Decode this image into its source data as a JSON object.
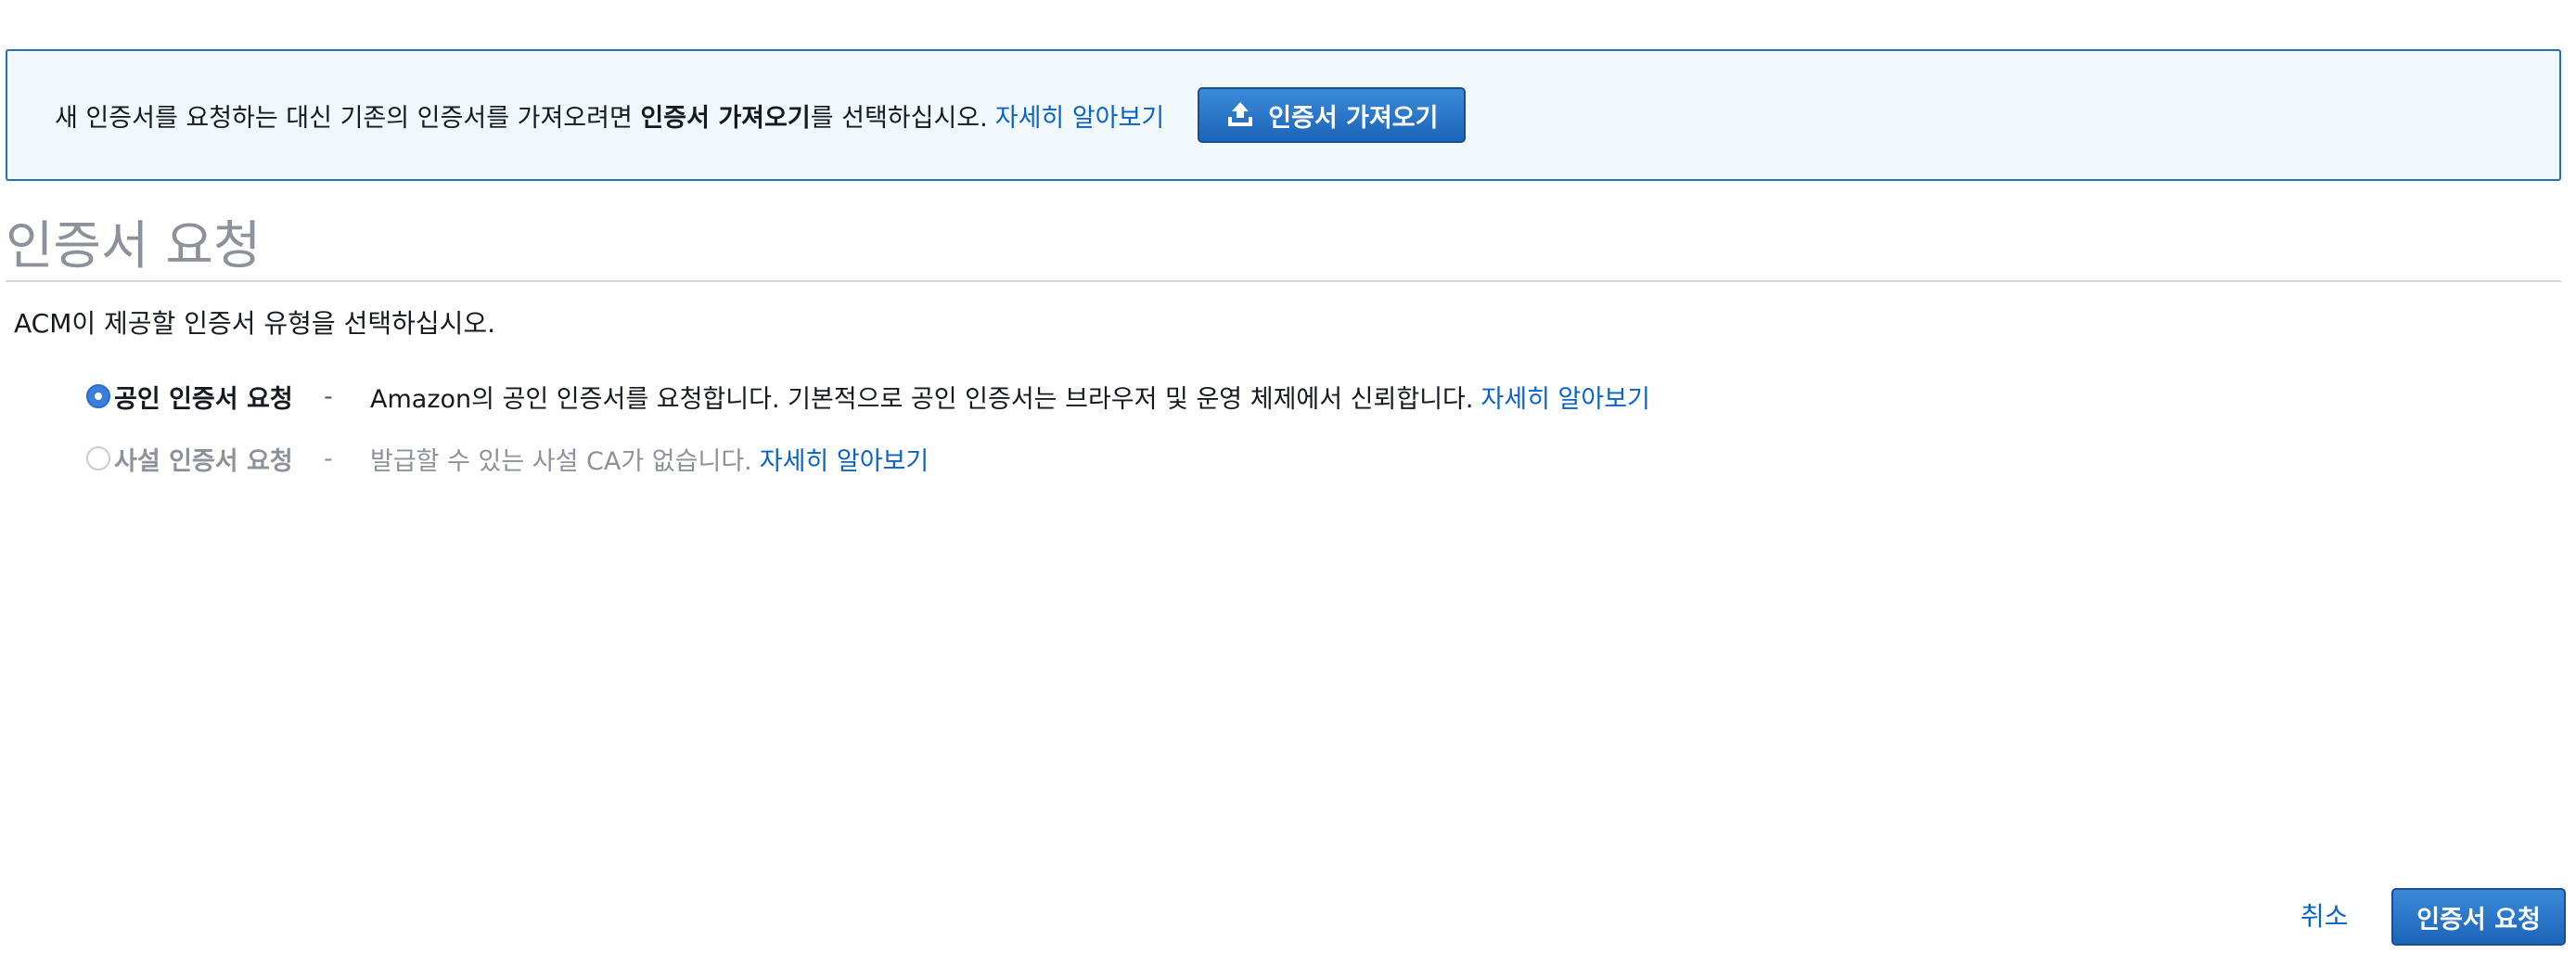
{
  "banner": {
    "text_before": "새 인증서를 요청하는 대신 기존의 인증서를 가져오려면 ",
    "text_bold": "인증서 가져오기",
    "text_after": "를 선택하십시오.",
    "learn_more": "자세히 알아보기",
    "import_button": "인증서 가져오기",
    "import_icon": "upload-icon"
  },
  "page": {
    "title": "인증서 요청",
    "subtitle": "ACM이 제공할 인증서 유형을 선택하십시오."
  },
  "options": [
    {
      "label": "공인 인증서 요청",
      "dash": "-",
      "description": "Amazon의 공인 인증서를 요청합니다. 기본적으로 공인 인증서는 브라우저 및 운영 체제에서 신뢰합니다.",
      "learn_more": "자세히 알아보기",
      "selected": true,
      "enabled": true
    },
    {
      "label": "사설 인증서 요청",
      "dash": "-",
      "description": "발급할 수 있는 사설 CA가 없습니다.",
      "learn_more": "자세히 알아보기",
      "selected": false,
      "enabled": false
    }
  ],
  "footer": {
    "cancel": "취소",
    "request_button": "인증서 요청"
  },
  "colors": {
    "accent": "#1c64b8",
    "link": "#0b63c6",
    "banner_bg": "#f1f8fe",
    "banner_border": "#2a6fb4",
    "muted": "#8d9199"
  }
}
